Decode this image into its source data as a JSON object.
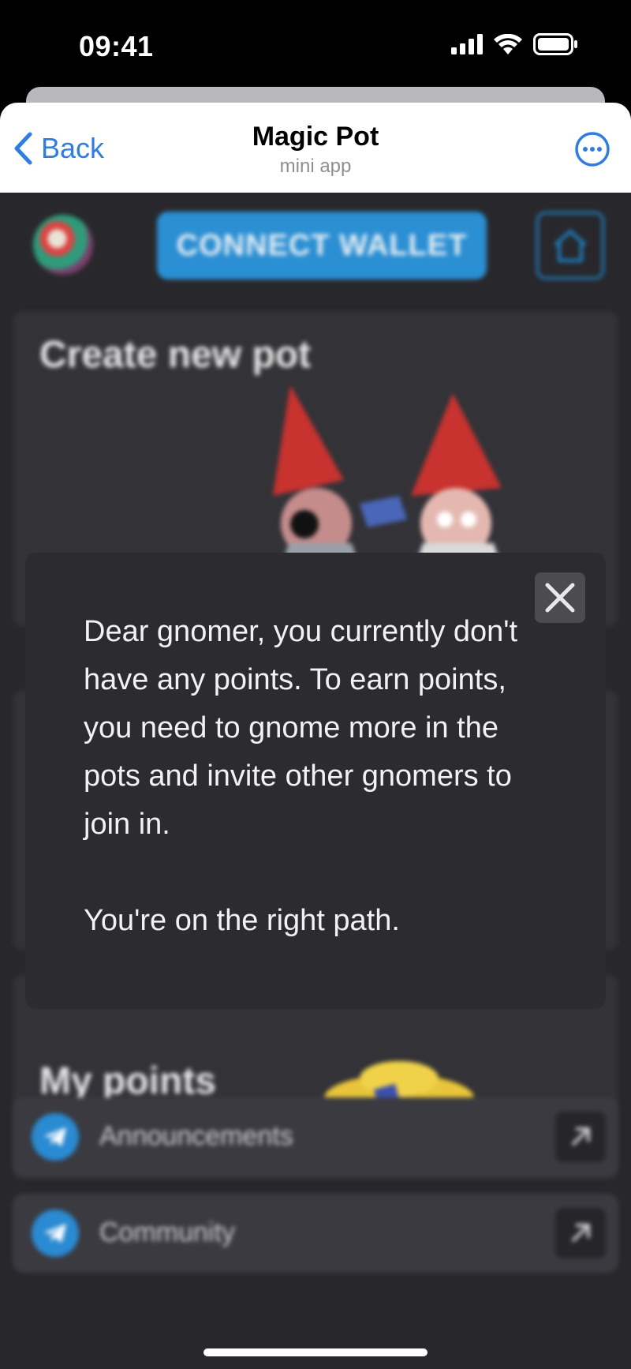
{
  "status_bar": {
    "time": "09:41",
    "icons": [
      "signal-icon",
      "wifi-icon",
      "battery-icon"
    ]
  },
  "header": {
    "back_label": "Back",
    "title": "Magic Pot",
    "subtitle": "mini app"
  },
  "app": {
    "connect_wallet_label": "CONNECT WALLET",
    "create_pot_title": "Create new pot",
    "my_points_title": "My points",
    "links": [
      {
        "label": "Announcements",
        "icon": "telegram-icon"
      },
      {
        "label": "Community",
        "icon": "telegram-icon"
      }
    ]
  },
  "modal": {
    "message": "Dear gnomer, you currently don't have any points. To earn points, you need to gnome more in the pots and invite other gnomers to join in.",
    "message_2": "You're on the right path."
  },
  "colors": {
    "accent": "#2f7de1",
    "connect_button": "#2b8fd3",
    "background": "#28282c",
    "modal": "#2c2c30"
  }
}
